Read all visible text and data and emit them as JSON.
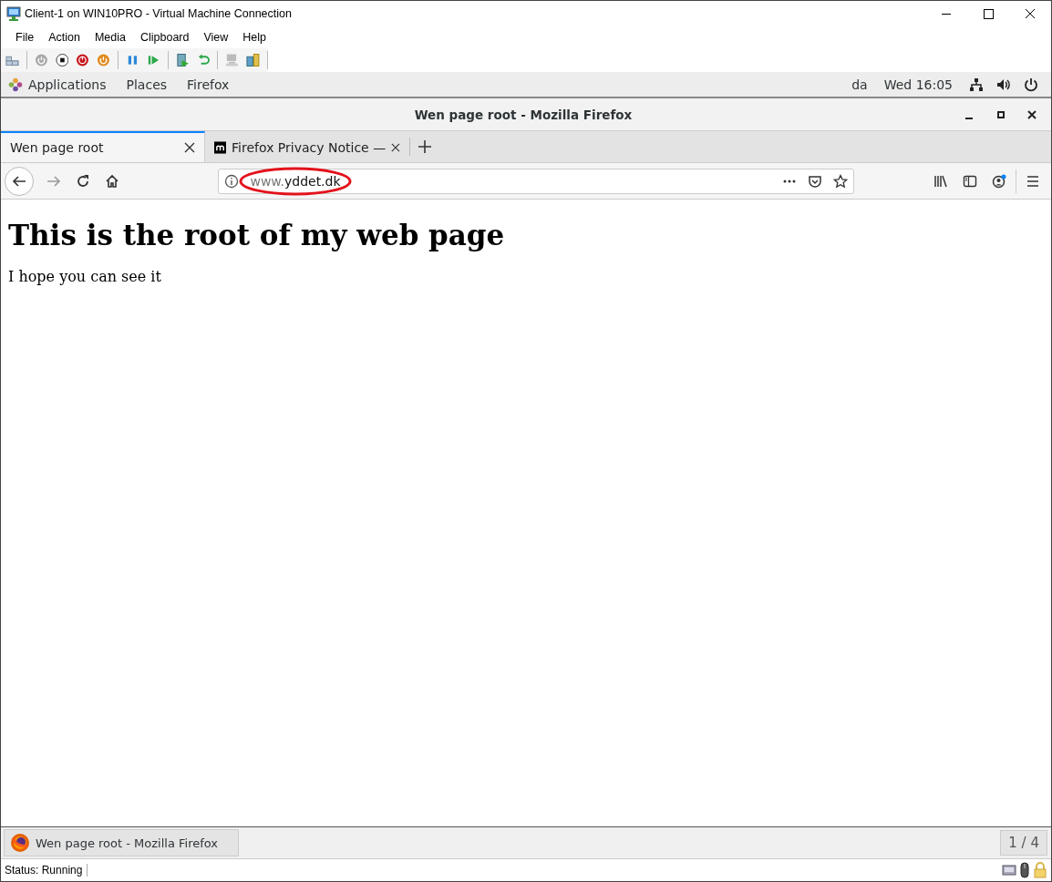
{
  "window": {
    "title": "Client-1 on WIN10PRO - Virtual Machine Connection"
  },
  "menu": [
    "File",
    "Action",
    "Media",
    "Clipboard",
    "View",
    "Help"
  ],
  "topbar": {
    "items": [
      "Applications",
      "Places",
      "Firefox"
    ],
    "keyboard": "da",
    "clock": "Wed 16:05"
  },
  "firefox": {
    "title": "Wen page root - Mozilla Firefox",
    "tabs": [
      {
        "label": "Wen page root",
        "selected": true
      },
      {
        "label": "Firefox Privacy Notice —",
        "selected": false
      }
    ],
    "url": {
      "host_prefix": "www.",
      "host": "yddet.dk",
      "circled": true
    },
    "page": {
      "heading": "This is the root of my web page",
      "paragraph": "I hope you can see it"
    }
  },
  "taskbar": {
    "task": "Wen page root - Mozilla Firefox",
    "workspace": "1 / 4"
  },
  "status_bar": {
    "status": "Status: Running"
  }
}
